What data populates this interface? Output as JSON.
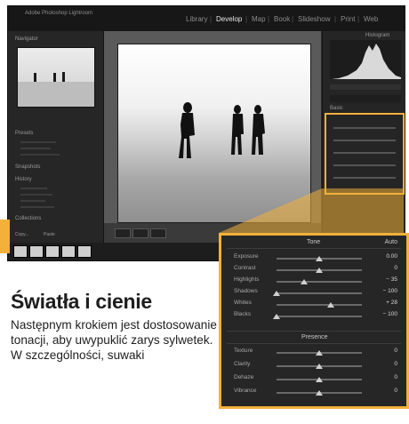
{
  "app": {
    "title": "Adobe Photoshop Lightroom",
    "modules": [
      "Library",
      "Develop",
      "Map",
      "Book",
      "Slideshow",
      "Print",
      "Web"
    ],
    "active_module": "Develop",
    "left_panel": {
      "navigator_title": "Navigator",
      "presets_title": "Presets",
      "snapshots_title": "Snapshots",
      "history_title": "History",
      "collections_title": "Collections"
    },
    "right_panel": {
      "histogram_title": "Histogram",
      "basic_title": "Basic"
    },
    "toolbar": {
      "copy_label": "Copy...",
      "paste_label": "Paste"
    }
  },
  "zoom_panel": {
    "header": {
      "tone_label": "Tone",
      "auto_label": "Auto"
    },
    "tone_rows": [
      {
        "label": "Exposure",
        "value": "0.00",
        "level": 0.5
      },
      {
        "label": "Contrast",
        "value": "0",
        "level": 0.5
      },
      {
        "label": "Highlights",
        "value": "− 35",
        "level": 0.32
      },
      {
        "label": "Shadows",
        "value": "− 100",
        "level": 0.0
      },
      {
        "label": "Whites",
        "value": "+ 28",
        "level": 0.64
      },
      {
        "label": "Blacks",
        "value": "− 100",
        "level": 0.0
      }
    ],
    "presence_label": "Presence",
    "presence_rows": [
      {
        "label": "Texture",
        "value": "0",
        "level": 0.5
      },
      {
        "label": "Clarity",
        "value": "0",
        "level": 0.5
      },
      {
        "label": "Dehaze",
        "value": "0",
        "level": 0.5
      },
      {
        "label": "Vibrance",
        "value": "0",
        "level": 0.5
      }
    ]
  },
  "article": {
    "heading": "Światła i cienie",
    "body": "Następnym krokiem jest dostosowanie tonacji, aby uwypuklić zarys sylwetek. W szczególności, suwaki"
  },
  "colors": {
    "accent": "#f3b13a",
    "ui_dark": "#262626"
  }
}
